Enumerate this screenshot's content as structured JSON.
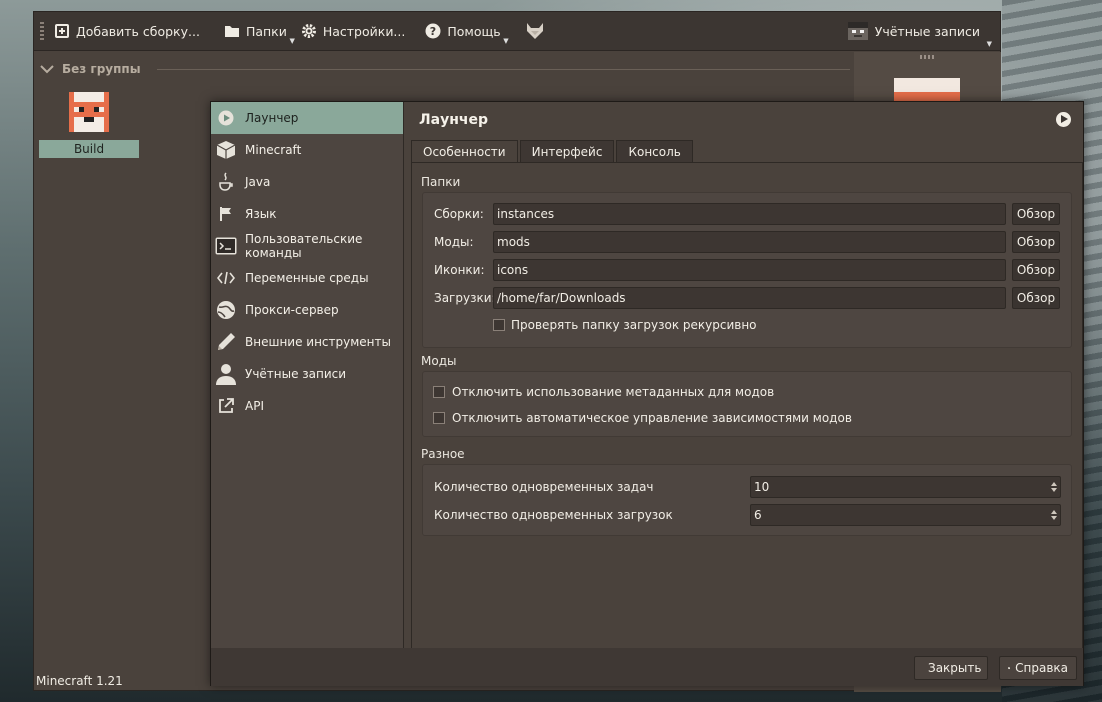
{
  "main_window": {
    "toolbar": {
      "add_instance": "Добавить сборку...",
      "folders": "Папки",
      "settings": "Настройки...",
      "help": "Помощь",
      "accounts": "Учётные записи"
    },
    "group_name": "Без группы",
    "instance_name": "Build",
    "status_text": "Minecraft 1.21"
  },
  "dialog": {
    "nav": [
      {
        "label": "Лаунчер",
        "icon": "launcher-icon"
      },
      {
        "label": "Minecraft",
        "icon": "minecraft-icon"
      },
      {
        "label": "Java",
        "icon": "java-icon"
      },
      {
        "label": "Язык",
        "icon": "flag-icon"
      },
      {
        "label": "Пользовательские команды",
        "icon": "terminal-icon"
      },
      {
        "label": "Переменные среды",
        "icon": "code-icon"
      },
      {
        "label": "Прокси-сервер",
        "icon": "globe-icon"
      },
      {
        "label": "Внешние инструменты",
        "icon": "pencil-icon"
      },
      {
        "label": "Учётные записи",
        "icon": "user-icon"
      },
      {
        "label": "API",
        "icon": "external-link-icon"
      }
    ],
    "title": "Лаунчер",
    "tabs": [
      "Особенности",
      "Интерфейс",
      "Консоль"
    ],
    "folders_group": {
      "title": "Папки",
      "rows": [
        {
          "label": "Сборки:",
          "value": "instances",
          "button": "Обзор"
        },
        {
          "label": "Моды:",
          "value": "mods",
          "button": "Обзор"
        },
        {
          "label": "Иконки:",
          "value": "icons",
          "button": "Обзор"
        },
        {
          "label": "Загрузки:",
          "value": "/home/far/Downloads",
          "button": "Обзор"
        }
      ],
      "recursive_check": "Проверять папку загрузок рекурсивно"
    },
    "mods_group": {
      "title": "Моды",
      "check1": "Отключить использование метаданных для модов",
      "check2": "Отключить автоматическое управление зависимостями модов"
    },
    "misc_group": {
      "title": "Разное",
      "tasks_label": "Количество одновременных задач",
      "tasks_value": "10",
      "downloads_label": "Количество одновременных загрузок",
      "downloads_value": "6"
    },
    "footer": {
      "close": "Закрыть",
      "help": "Справка"
    }
  },
  "colors": {
    "accent": "#8aa89a",
    "window_bg": "#4a423c",
    "fox_orange": "#e66e4a"
  }
}
